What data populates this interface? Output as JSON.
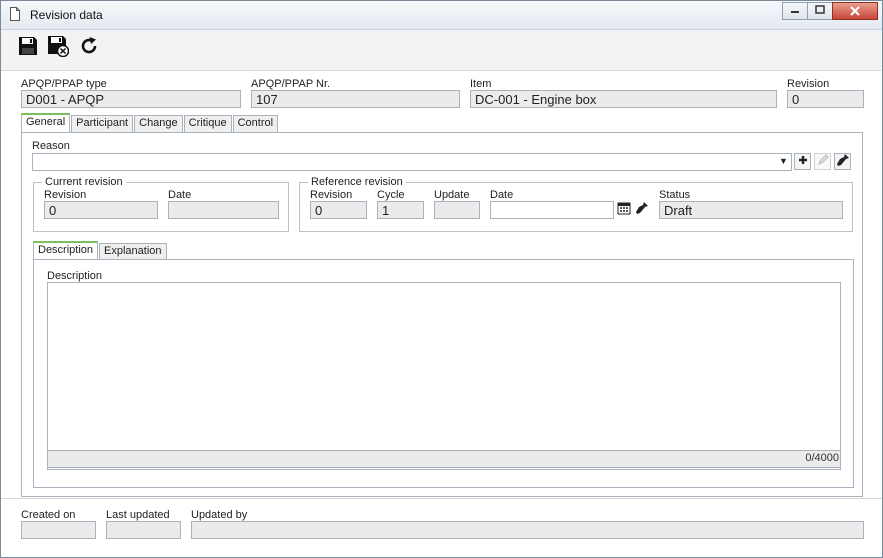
{
  "window": {
    "title": "Revision data"
  },
  "toolbar": {
    "save": "save-icon",
    "save_close": "save-close-icon",
    "refresh": "refresh-icon"
  },
  "header": {
    "type_label": "APQP/PPAP type",
    "type_value": "D001 - APQP",
    "nr_label": "APQP/PPAP Nr.",
    "nr_value": "107",
    "item_label": "Item",
    "item_value": "DC-001 - Engine box",
    "revision_label": "Revision",
    "revision_value": "0"
  },
  "tabs": [
    "General",
    "Participant",
    "Change",
    "Critique",
    "Control"
  ],
  "general": {
    "reason_label": "Reason",
    "reason_value": "",
    "current_revision": {
      "legend": "Current revision",
      "revision_label": "Revision",
      "revision_value": "0",
      "date_label": "Date",
      "date_value": ""
    },
    "reference_revision": {
      "legend": "Reference revision",
      "revision_label": "Revision",
      "revision_value": "0",
      "cycle_label": "Cycle",
      "cycle_value": "1",
      "update_label": "Update",
      "update_value": "",
      "date_label": "Date",
      "date_value": "",
      "status_label": "Status",
      "status_value": "Draft"
    },
    "subtabs": [
      "Description",
      "Explanation"
    ],
    "description_label": "Description",
    "description_value": "",
    "counter": "0/4000"
  },
  "footer": {
    "created_label": "Created on",
    "created_value": "",
    "updated_label": "Last updated",
    "updated_value": "",
    "updated_by_label": "Updated by",
    "updated_by_value": ""
  }
}
